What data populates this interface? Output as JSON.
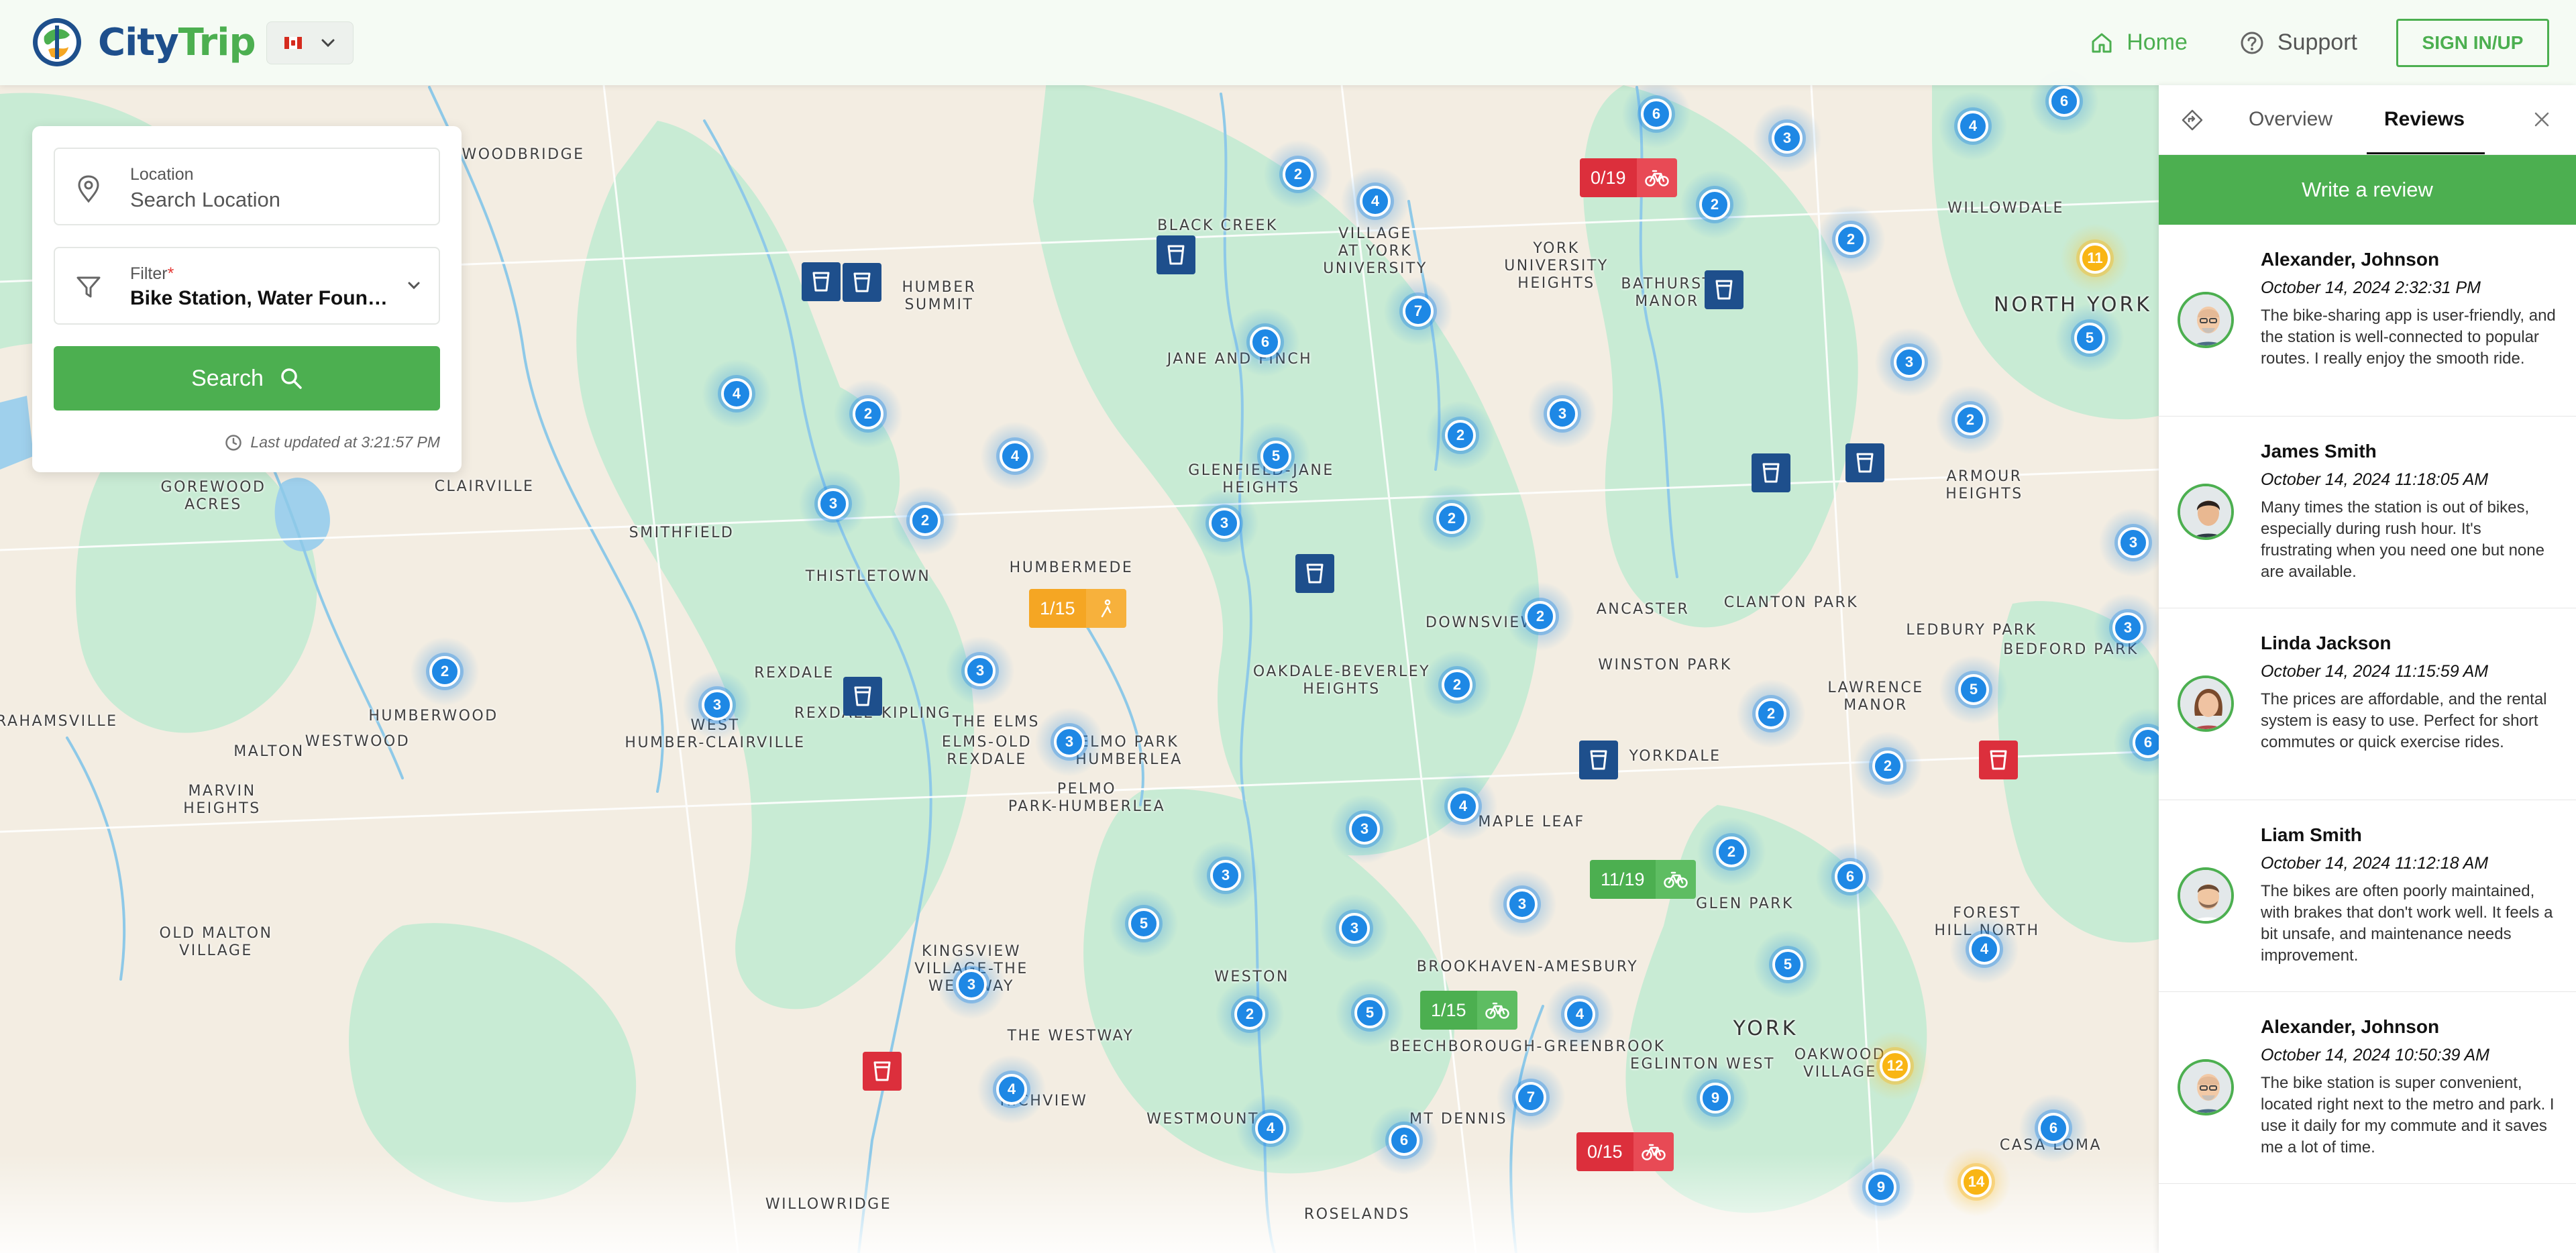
{
  "header": {
    "logo_part1": "City",
    "logo_part2": "Trip",
    "nav": [
      {
        "label": "Home",
        "icon": "home-icon",
        "active": true
      },
      {
        "label": "Support",
        "icon": "help-circle-icon",
        "active": false
      }
    ],
    "signin_label": "SIGN IN/UP",
    "language_flag": "canada-flag-icon"
  },
  "search_card": {
    "location_label": "Location",
    "location_placeholder": "Search Location",
    "filter_label": "Filter",
    "filter_required_mark": "*",
    "filter_value": "Bike Station, Water Fountain",
    "search_button": "Search",
    "last_updated": "Last updated at 3:21:57 PM"
  },
  "panel": {
    "tabs": [
      "Overview",
      "Reviews"
    ],
    "active_tab": "Reviews",
    "write_review": "Write a review",
    "reviews": [
      {
        "name": "Alexander, Johnson",
        "date": "October 14, 2024 2:32:31 PM",
        "text": "The bike-sharing app is user-friendly, and the station is well-connected to popular routes. I really enjoy the smooth ride.",
        "avatar": "avatar-bald-man"
      },
      {
        "name": "James Smith",
        "date": "October 14, 2024 11:18:05 AM",
        "text": "Many times the station is out of bikes, especially during rush hour. It's frustrating when you need one but none are available.",
        "avatar": "avatar-dark-hair-man"
      },
      {
        "name": "Linda Jackson",
        "date": "October 14, 2024 11:15:59 AM",
        "text": "The prices are affordable, and the rental system is easy to use. Perfect for short commutes or quick exercise rides.",
        "avatar": "avatar-woman"
      },
      {
        "name": "Liam Smith",
        "date": "October 14, 2024 11:12:18 AM",
        "text": "The bikes are often poorly maintained, with brakes that don't work well. It feels a bit unsafe, and maintenance needs improvement.",
        "avatar": "avatar-man-beard"
      },
      {
        "name": "Alexander, Johnson",
        "date": "October 14, 2024 10:50:39 AM",
        "text": "The bike station is super convenient, located right next to the metro and park. I use it daily for my commute and it saves me a lot of time.",
        "avatar": "avatar-bald-man"
      }
    ]
  },
  "map": {
    "colors": {
      "land": "#f3ede2",
      "park": "#c8ebd4",
      "water": "#9fd0ec",
      "cluster": "#1e88e5",
      "cluster_hot": "#f9b514",
      "fountain": "#1e4f8c",
      "alert": "#dc2f3c",
      "ok": "#4caf50",
      "warn": "#f5a623"
    },
    "places": [
      {
        "text": "WOODBRIDGE"
      },
      {
        "text": "HUMBER\nSUMMIT"
      },
      {
        "text": "BLACK CREEK"
      },
      {
        "text": "VILLAGE\nAT YORK\nUNIVERSITY"
      },
      {
        "text": "YORK\nUNIVERSITY\nHEIGHTS"
      },
      {
        "text": "BATHURST\nMANOR"
      },
      {
        "text": "WILLOWDALE"
      },
      {
        "text": "NORTH YORK",
        "big": true
      },
      {
        "text": "JANE AND FINCH"
      },
      {
        "text": "GOREWOOD\nACRES"
      },
      {
        "text": "CLAIRVILLE"
      },
      {
        "text": "SMITHFIELD"
      },
      {
        "text": "GLENFIELD-JANE\nHEIGHTS"
      },
      {
        "text": "THISTLETOWN"
      },
      {
        "text": "HUMBERMEDE"
      },
      {
        "text": "ARMOUR\nHEIGHTS"
      },
      {
        "text": "DOWNSVIEW"
      },
      {
        "text": "ANCASTER"
      },
      {
        "text": "CLANTON PARK"
      },
      {
        "text": "LEDBURY PARK"
      },
      {
        "text": "BEDFORD PARK"
      },
      {
        "text": "WINSTON PARK"
      },
      {
        "text": "REXDALE"
      },
      {
        "text": "OAKDALE-BEVERLEY\nHEIGHTS"
      },
      {
        "text": "LAWRENCE\nMANOR"
      },
      {
        "text": "HUMBERWOOD"
      },
      {
        "text": "WEST\nHUMBER-CLAIRVILLE"
      },
      {
        "text": "REXDALE-KIPLING"
      },
      {
        "text": "THE ELMS"
      },
      {
        "text": "ELMS-OLD\nREXDALE"
      },
      {
        "text": "ELMO PARK\nHUMBERLEA"
      },
      {
        "text": "GRAHAMSVILLE"
      },
      {
        "text": "MALTON"
      },
      {
        "text": "WESTWOOD"
      },
      {
        "text": "MARVIN\nHEIGHTS"
      },
      {
        "text": "YORKDALE"
      },
      {
        "text": "PELMO\nPARK-HUMBERLEA"
      },
      {
        "text": "MAPLE LEAF"
      },
      {
        "text": "GLEN PARK"
      },
      {
        "text": "FOREST\nHILL NORTH"
      },
      {
        "text": "OLD MALTON\nVILLAGE"
      },
      {
        "text": "KINGSVIEW\nVILLAGE-THE\nWESTWAY"
      },
      {
        "text": "WESTON"
      },
      {
        "text": "BROOKHAVEN-AMESBURY"
      },
      {
        "text": "THE WESTWAY"
      },
      {
        "text": "BEECHBOROUGH-GREENBROOK"
      },
      {
        "text": "EGLINTON WEST"
      },
      {
        "text": "YORK",
        "big": true
      },
      {
        "text": "OAKWOOD\nVILLAGE"
      },
      {
        "text": "RICHVIEW"
      },
      {
        "text": "WESTMOUNT"
      },
      {
        "text": "MT DENNIS"
      },
      {
        "text": "CASA LOMA"
      },
      {
        "text": "WILLOWRIDGE"
      },
      {
        "text": "ROSELANDS"
      }
    ],
    "clusters": [
      {
        "n": 6
      },
      {
        "n": 6
      },
      {
        "n": 4
      },
      {
        "n": 3
      },
      {
        "n": 2
      },
      {
        "n": 4
      },
      {
        "n": 2
      },
      {
        "n": 2
      },
      {
        "n": 11,
        "hot": true
      },
      {
        "n": 7
      },
      {
        "n": 6
      },
      {
        "n": 5
      },
      {
        "n": 3
      },
      {
        "n": 4
      },
      {
        "n": 2
      },
      {
        "n": 2
      },
      {
        "n": 3
      },
      {
        "n": 2
      },
      {
        "n": 4
      },
      {
        "n": 3
      },
      {
        "n": 2
      },
      {
        "n": 5
      },
      {
        "n": 3
      },
      {
        "n": 2
      },
      {
        "n": 3
      },
      {
        "n": 2
      },
      {
        "n": 3
      },
      {
        "n": 3
      },
      {
        "n": 3
      },
      {
        "n": 2
      },
      {
        "n": 2
      },
      {
        "n": 5
      },
      {
        "n": 2
      },
      {
        "n": 6
      },
      {
        "n": 3
      },
      {
        "n": 2
      },
      {
        "n": 4
      },
      {
        "n": 3
      },
      {
        "n": 3
      },
      {
        "n": 2
      },
      {
        "n": 6
      },
      {
        "n": 3
      },
      {
        "n": 5
      },
      {
        "n": 3
      },
      {
        "n": 5
      },
      {
        "n": 4
      },
      {
        "n": 3
      },
      {
        "n": 5
      },
      {
        "n": 4
      },
      {
        "n": 2
      },
      {
        "n": 12,
        "hot": true
      },
      {
        "n": 9
      },
      {
        "n": 4
      },
      {
        "n": 4
      },
      {
        "n": 6
      },
      {
        "n": 7
      },
      {
        "n": 6
      },
      {
        "n": 9
      },
      {
        "n": 14,
        "hot": true
      }
    ],
    "fountains": [
      {
        "alert": false
      },
      {
        "alert": false
      },
      {
        "alert": false
      },
      {
        "alert": false
      },
      {
        "alert": false
      },
      {
        "alert": false
      },
      {
        "alert": false
      },
      {
        "alert": false
      },
      {
        "alert": true
      },
      {
        "alert": true
      },
      {
        "alert": false
      }
    ],
    "stations": [
      {
        "label": "0/19",
        "status": "red"
      },
      {
        "label": "1/15",
        "status": "orange"
      },
      {
        "label": "11/19",
        "status": "green"
      },
      {
        "label": "1/15",
        "status": "green"
      },
      {
        "label": "0/15",
        "status": "red"
      }
    ]
  }
}
